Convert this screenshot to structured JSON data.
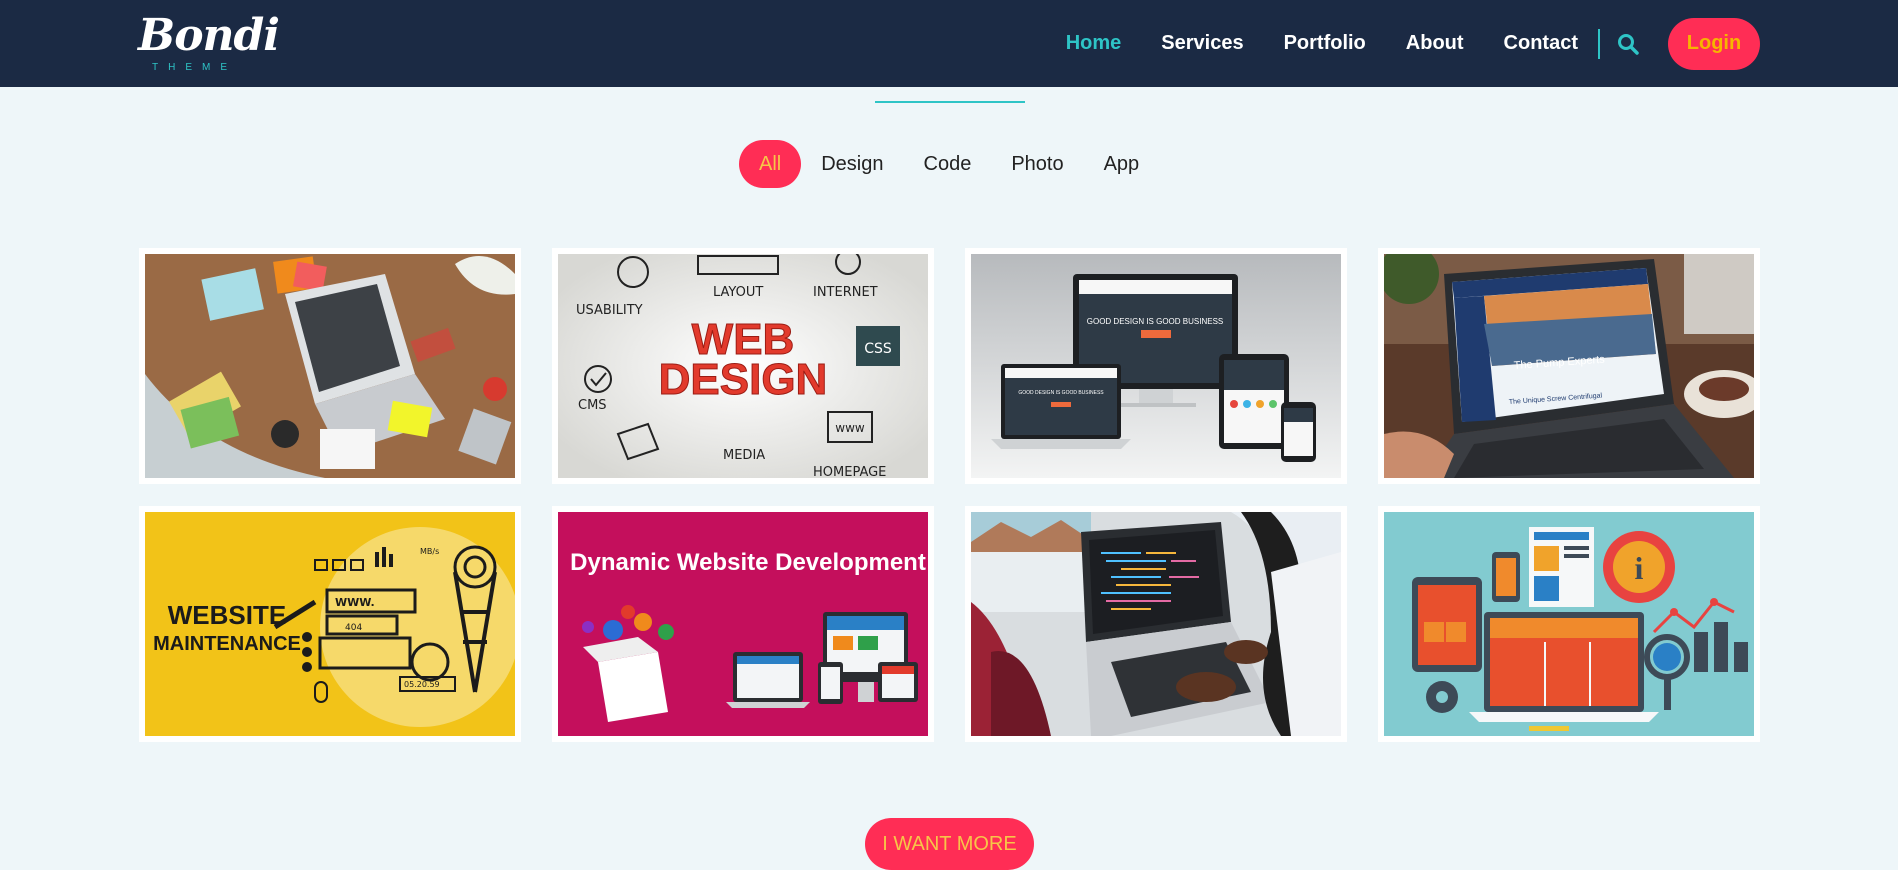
{
  "brand": {
    "name": "Bondi",
    "tagline": "THEME"
  },
  "nav": {
    "items": [
      {
        "label": "Home",
        "active": true
      },
      {
        "label": "Services"
      },
      {
        "label": "Portfolio"
      },
      {
        "label": "About"
      },
      {
        "label": "Contact"
      }
    ],
    "search_icon": "search-icon",
    "login_label": "Login"
  },
  "filters": {
    "items": [
      {
        "label": "All",
        "active": true
      },
      {
        "label": "Design"
      },
      {
        "label": "Code"
      },
      {
        "label": "Photo"
      },
      {
        "label": "App"
      }
    ]
  },
  "portfolio": {
    "items": [
      {
        "title": "Workspace laptop top view"
      },
      {
        "title": "Web design concept",
        "words": {
          "main1": "WEB",
          "main2": "DESIGN",
          "usability": "USABILITY",
          "layout": "LAYOUT",
          "internet": "INTERNET",
          "css": "CSS",
          "cms": "CMS",
          "media": "MEDIA",
          "www": "www",
          "homepage": "HOMEPAGE"
        }
      },
      {
        "title": "Responsive devices",
        "words": {
          "headline": "GOOD DESIGN IS GOOD BUSINESS",
          "headline_small": "GOOD DESIGN IS GOOD BUSINESS"
        }
      },
      {
        "title": "Laptop on cafe table",
        "words": {
          "site_heading": "The Pump Experts",
          "site_sub": "The Unique Screw Centrifugal"
        }
      },
      {
        "title": "Website maintenance",
        "words": {
          "line1": "WEBSITE",
          "line2": "MAINTENANCE",
          "url": "WWW.",
          "code": "404",
          "time": "05.20.59",
          "rate": "MB/s"
        }
      },
      {
        "title": "Dynamic website development",
        "words": {
          "headline": "Dynamic Website Development"
        }
      },
      {
        "title": "Coding on laptop"
      },
      {
        "title": "Analytics illustration",
        "words": {
          "info": "i"
        }
      }
    ]
  },
  "cta": {
    "label": "I WANT MORE"
  },
  "colors": {
    "navy": "#1b2a44",
    "teal": "#2ec4c6",
    "pink": "#ff2d55",
    "yellow": "#f7c548",
    "bg": "#eef6f9"
  }
}
